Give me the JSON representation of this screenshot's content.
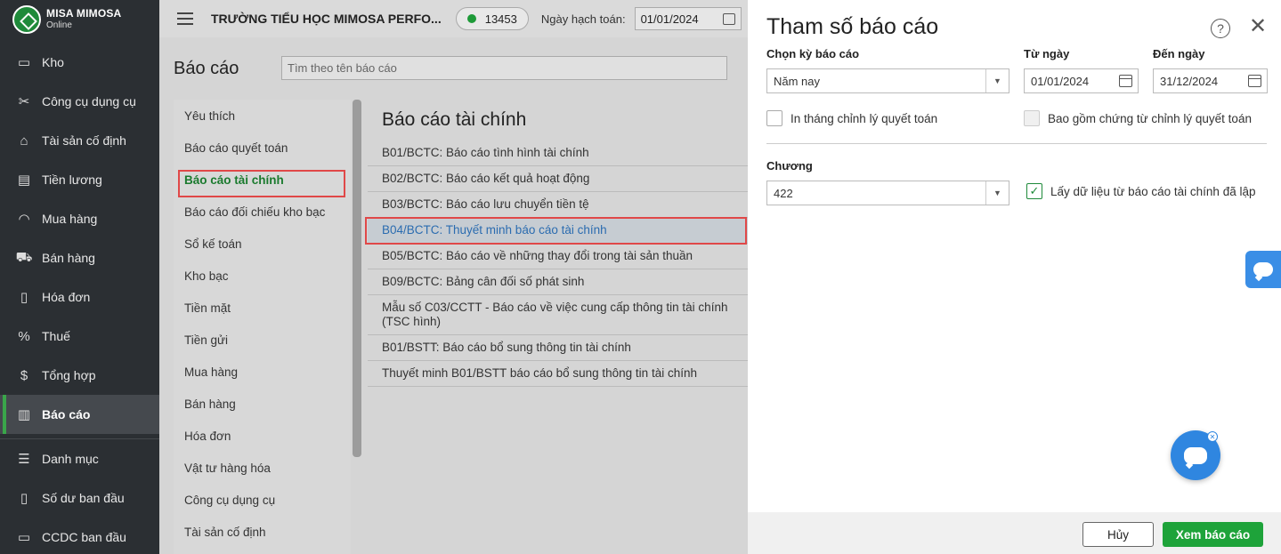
{
  "brand": {
    "name": "MISA MIMOSA",
    "sub": "Online"
  },
  "sidebar": {
    "items": [
      {
        "label": "Kho",
        "icon": "box-icon"
      },
      {
        "label": "Công cụ dụng cụ",
        "icon": "tools-icon"
      },
      {
        "label": "Tài sản cố định",
        "icon": "building-icon"
      },
      {
        "label": "Tiền lương",
        "icon": "salary-icon"
      },
      {
        "label": "Mua hàng",
        "icon": "bag-icon"
      },
      {
        "label": "Bán hàng",
        "icon": "cart-icon"
      },
      {
        "label": "Hóa đơn",
        "icon": "invoice-icon"
      },
      {
        "label": "Thuế",
        "icon": "tax-icon"
      },
      {
        "label": "Tổng hợp",
        "icon": "summary-icon"
      },
      {
        "label": "Báo cáo",
        "icon": "report-icon",
        "active": true
      },
      {
        "label": "Danh mục",
        "icon": "list-icon"
      },
      {
        "label": "Số dư ban đầu",
        "icon": "balance-icon"
      },
      {
        "label": "CCDC ban đầu",
        "icon": "initial-icon"
      }
    ]
  },
  "topbar": {
    "school": "TRƯỜNG TIỂU HỌC MIMOSA PERFO...",
    "code": "13453",
    "date_label": "Ngày hạch toán:",
    "date_value": "01/01/2024"
  },
  "page": {
    "title": "Báo cáo",
    "search_placeholder": "Tìm theo tên báo cáo"
  },
  "categories": [
    "Yêu thích",
    "Báo cáo quyết toán",
    "Báo cáo tài chính",
    "Báo cáo đối chiếu kho bạc",
    "Sổ kế toán",
    "Kho bạc",
    "Tiền mặt",
    "Tiền gửi",
    "Mua hàng",
    "Bán hàng",
    "Hóa đơn",
    "Vật tư hàng hóa",
    "Công cụ dụng cụ",
    "Tài sản cố định"
  ],
  "reports": {
    "title": "Báo cáo tài chính",
    "items": [
      "B01/BCTC: Báo cáo tình hình tài chính",
      "B02/BCTC: Báo cáo kết quả hoạt động",
      "B03/BCTC: Báo cáo lưu chuyển tiền tệ",
      "B04/BCTC: Thuyết minh báo cáo tài chính",
      "B05/BCTC: Báo cáo về những thay đổi trong tài sản thuần",
      "B09/BCTC: Bảng cân đối số phát sinh",
      "Mẫu số C03/CCTT - Báo cáo về việc cung cấp thông tin tài chính (TSC hình)",
      "B01/BSTT: Báo cáo bổ sung thông tin tài chính",
      "Thuyết minh B01/BSTT báo cáo bổ sung thông tin tài chính"
    ]
  },
  "dialog": {
    "title": "Tham số báo cáo",
    "period_label": "Chọn kỳ báo cáo",
    "period_value": "Năm nay",
    "from_label": "Từ ngày",
    "from_value": "01/01/2024",
    "to_label": "Đến ngày",
    "to_value": "31/12/2024",
    "chk_adjust_month": "In tháng chỉnh lý quyết toán",
    "chk_include_adjust": "Bao gồm chứng từ chỉnh lý quyết toán",
    "chapter_label": "Chương",
    "chapter_value": "422",
    "chk_use_data": "Lấy dữ liệu từ báo cáo tài chính đã lập",
    "cancel": "Hủy",
    "view": "Xem báo cáo"
  },
  "colors": {
    "accent_green": "#1ea33a",
    "highlight_red": "#e04848",
    "link_blue": "#2b6cb0"
  }
}
